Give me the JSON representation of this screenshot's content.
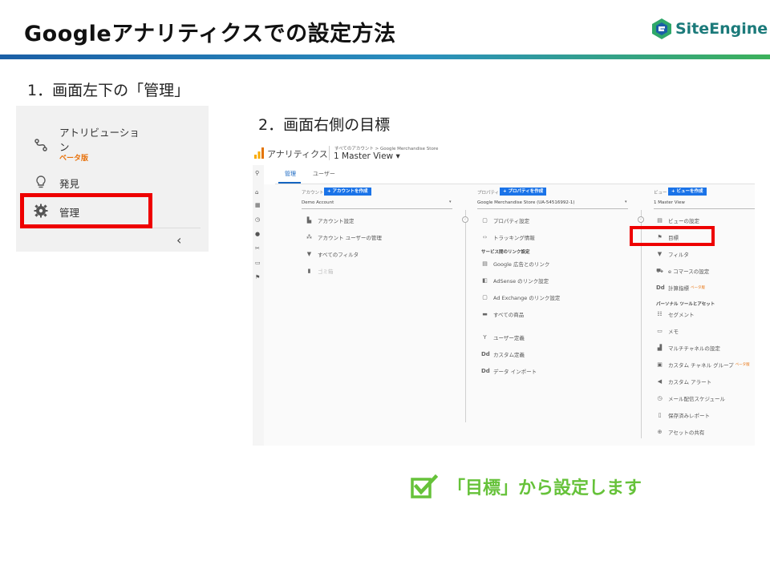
{
  "slide": {
    "title": "Googleアナリティクスでの設定方法",
    "logo_text": "SiteEngine",
    "step1": "1．画面左下の「管理」",
    "step2": "2．画面右側の目標",
    "conclusion": "「目標」から設定します"
  },
  "left_panel": {
    "attribution_line1": "アトリビューショ",
    "attribution_line2": "ン",
    "beta": "ベータ版",
    "discover": "発見",
    "admin": "管理"
  },
  "ga": {
    "app_name": "アナリティクス",
    "breadcrumb": "すべてのアカウント > Google Merchandise Store",
    "view": "1 Master View ▾",
    "tabs": [
      "管理",
      "ユーザー"
    ],
    "account": {
      "label": "アカウント",
      "create_button": "+ アカウントを作成",
      "selected": "Demo Account",
      "items": [
        "アカウント設定",
        "アカウント ユーザーの管理",
        "すべてのフィルタ",
        "ゴミ箱"
      ]
    },
    "property": {
      "label": "プロパティ",
      "create_button": "+ プロパティを作成",
      "selected": "Google Merchandise Store (UA-54516992-1)",
      "items": [
        "プロパティ設定",
        "トラッキング情報"
      ],
      "section": "サービス間のリンク設定",
      "links": [
        "Google 広告とのリンク",
        "AdSense のリンク設定",
        "Ad Exchange のリンク設定",
        "すべての商品"
      ],
      "items2": [
        "ユーザー定義",
        "カスタム定義",
        "データ インポート"
      ]
    },
    "view_col": {
      "label": "ビュー",
      "create_button": "+ ビューを作成",
      "selected": "1 Master View",
      "items": [
        "ビューの設定",
        "目標",
        "フィルタ",
        "e コマースの設定",
        "計算指標"
      ],
      "beta": "ベータ版",
      "section": "パーソナル ツールとアセット",
      "tools": [
        "セグメント",
        "メモ",
        "マルチチャネルの設定",
        "カスタム チャネル グループ",
        "カスタム アラート",
        "メール配信スケジュール",
        "保存済みレポート",
        "アセットの共有"
      ]
    }
  },
  "colors": {
    "accent_green": "#66c23a",
    "highlight_red": "#ee0000",
    "ga_blue": "#1a73e8"
  }
}
